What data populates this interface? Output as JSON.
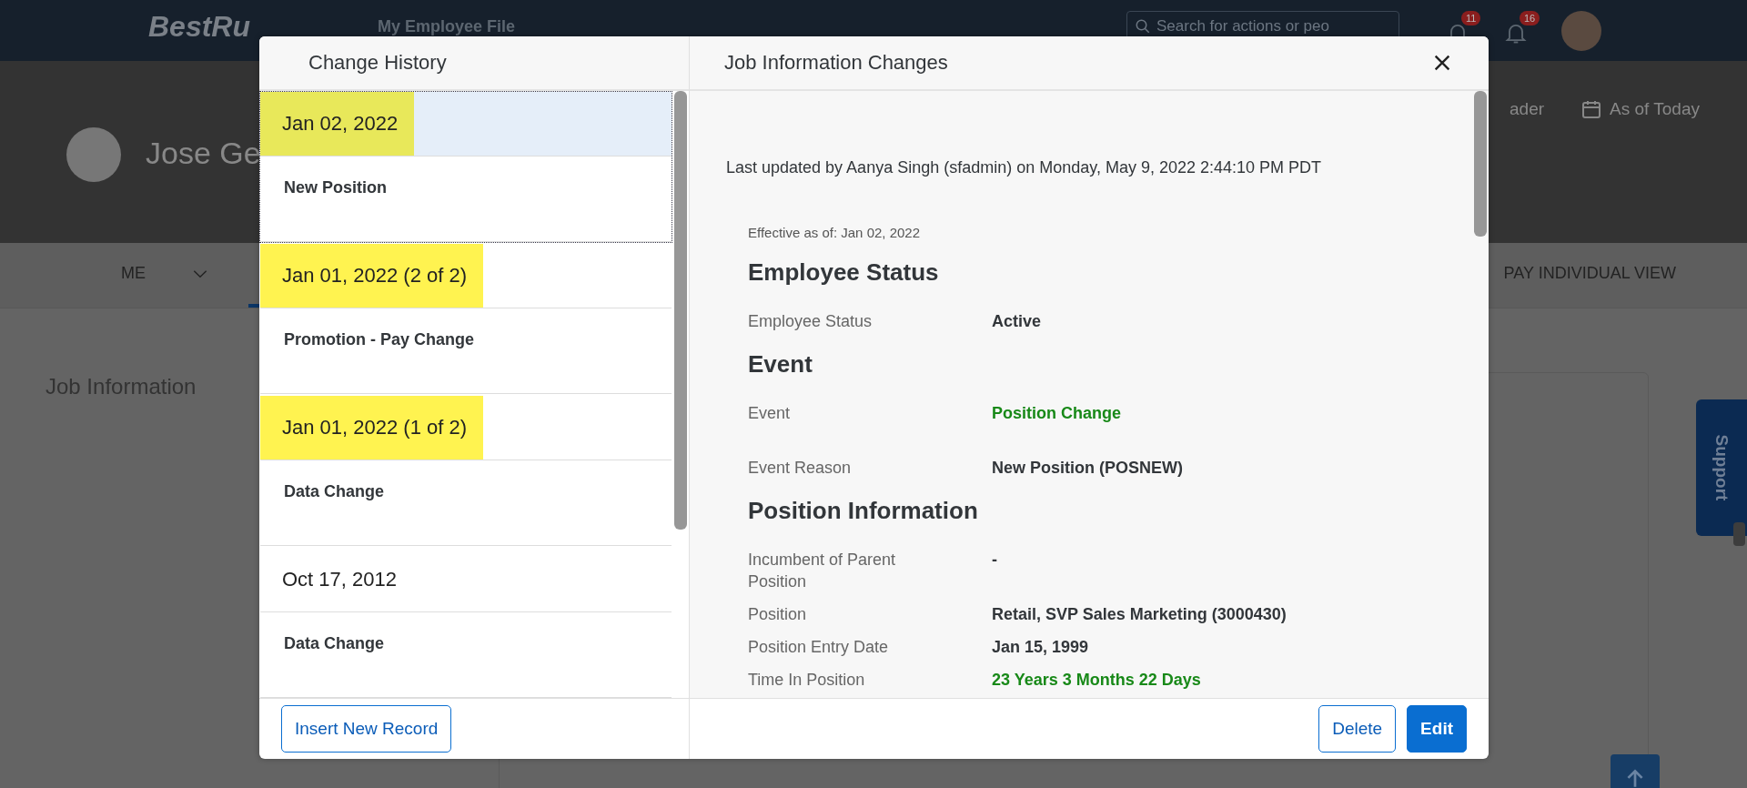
{
  "shell": {
    "logo": "BestRu",
    "menu": "My Employee File",
    "search": {
      "placeholder": "Search for actions or peo"
    },
    "badges": [
      "11",
      "16"
    ]
  },
  "profile": {
    "name": "Jose Ge",
    "actions": [
      {
        "kind": "text",
        "label": "ader"
      },
      {
        "kind": "calendar",
        "label": "As of Today"
      }
    ]
  },
  "tabs": [
    {
      "label": "ME",
      "selected": false
    },
    {
      "selected": true
    },
    {
      "label": "PAY INDIVIDUAL VIEW",
      "selected": false
    }
  ],
  "section_title": "Job Information",
  "support": "Support",
  "dialog": {
    "history_title": "Change History",
    "title": "Job Information Changes",
    "history": [
      {
        "date": "Jan 02, 2022",
        "event": "New Position",
        "highlighted": true,
        "selected": true
      },
      {
        "date": "Jan 01, 2022 (2 of 2)",
        "event": "Promotion - Pay Change",
        "highlighted": true,
        "selected": false
      },
      {
        "date": "Jan 01, 2022 (1 of 2)",
        "event": "Data Change",
        "highlighted": true,
        "selected": false
      },
      {
        "date": "Oct 17, 2012",
        "event": "Data Change",
        "highlighted": false,
        "selected": false
      }
    ],
    "insert_button": "Insert New Record",
    "last_updated": "Last updated by Aanya Singh (sfadmin) on Monday, May 9, 2022 2:44:10 PM PDT",
    "effective": "Effective as of: Jan 02, 2022",
    "sections": [
      {
        "heading": "Employee Status",
        "fields": [
          {
            "label": "Employee Status",
            "value": "Active",
            "changed": false
          }
        ]
      },
      {
        "heading": "Event",
        "fields": [
          {
            "label": "Event",
            "value": "Position Change",
            "changed": true
          },
          {
            "label": "Event Reason",
            "value": "New Position (POSNEW)",
            "changed": false
          }
        ]
      },
      {
        "heading": "Position Information",
        "fields": [
          {
            "label": "Incumbent of Parent Position",
            "value": "-",
            "changed": false
          },
          {
            "label": "Position",
            "value": "Retail, SVP Sales Marketing (3000430)",
            "changed": false
          },
          {
            "label": "Position Entry Date",
            "value": "Jan 15, 1999",
            "changed": false
          },
          {
            "label": "Time In Position",
            "value": "23 Years 3 Months 22 Days",
            "changed": true
          }
        ]
      }
    ],
    "buttons": [
      {
        "label": "Delete",
        "kind": "secondary"
      },
      {
        "label": "Edit",
        "kind": "primary"
      }
    ]
  }
}
